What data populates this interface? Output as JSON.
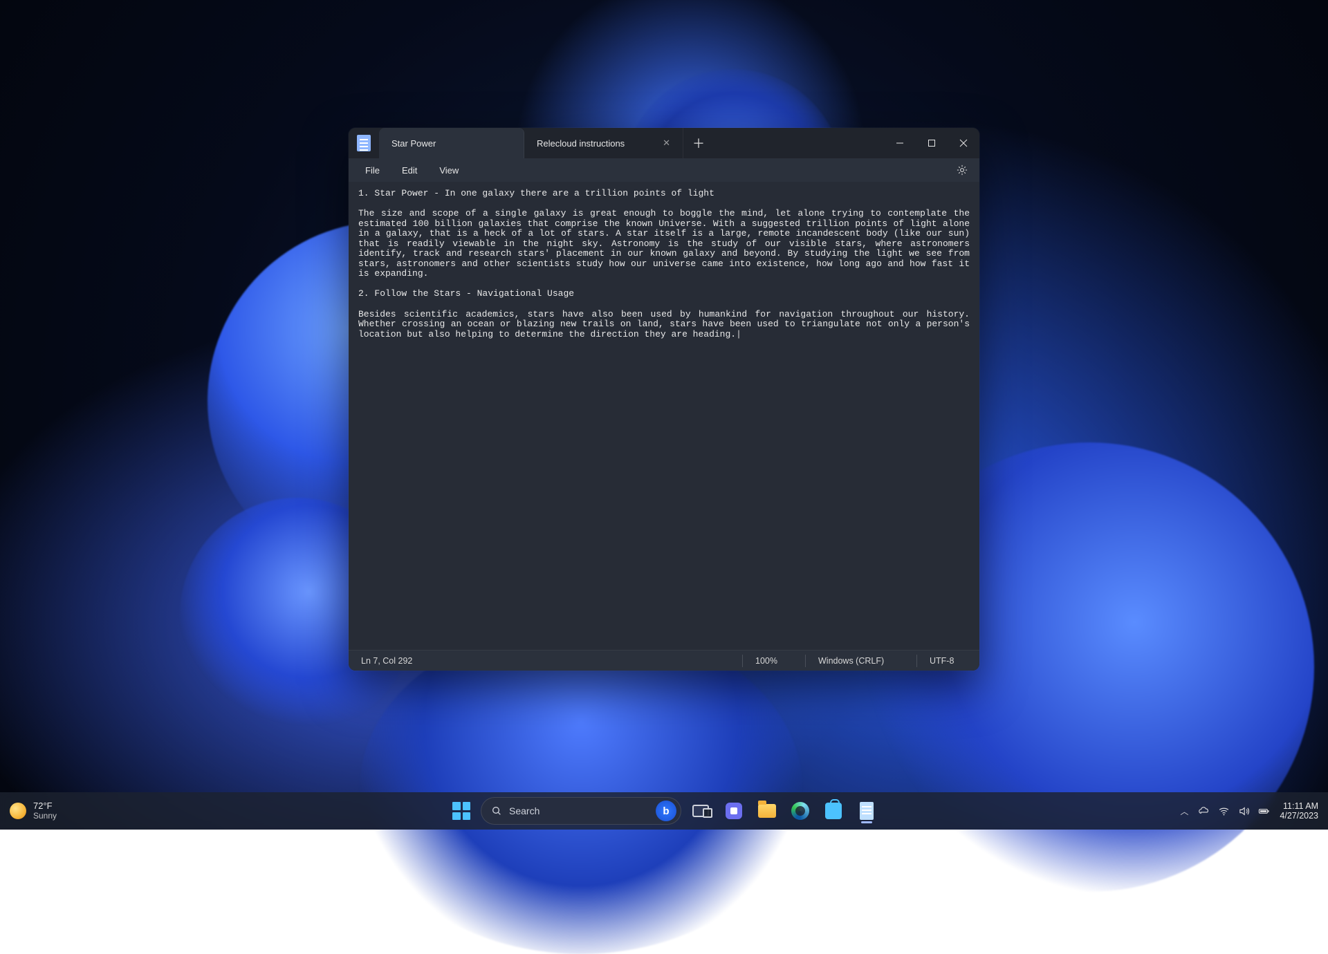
{
  "notepad": {
    "tabs": [
      {
        "title": "Star Power",
        "active": true
      },
      {
        "title": "Relecloud instructions",
        "active": false
      }
    ],
    "menu": {
      "file": "File",
      "edit": "Edit",
      "view": "View"
    },
    "content": "1. Star Power - In one galaxy there are a trillion points of light\n\nThe size and scope of a single galaxy is great enough to boggle the mind, let alone trying to contemplate the estimated 100 billion galaxies that comprise the known Universe. With a suggested trillion points of light alone in a galaxy, that is a heck of a lot of stars. A star itself is a large, remote incandescent body (like our sun) that is readily viewable in the night sky. Astronomy is the study of our visible stars, where astronomers identify, track and research stars' placement in our known galaxy and beyond. By studying the light we see from stars, astronomers and other scientists study how our universe came into existence, how long ago and how fast it is expanding.\n\n2. Follow the Stars - Navigational Usage\n\nBesides scientific academics, stars have also been used by humankind for navigation throughout our history. Whether crossing an ocean or blazing new trails on land, stars have been used to triangulate not only a person's location but also helping to determine the direction they are heading.",
    "status": {
      "position": "Ln 7, Col 292",
      "zoom": "100%",
      "line_ending": "Windows (CRLF)",
      "encoding": "UTF-8"
    }
  },
  "taskbar": {
    "weather": {
      "temp": "72°F",
      "cond": "Sunny"
    },
    "search_placeholder": "Search",
    "clock": {
      "time": "11:11 AM",
      "date": "4/27/2023"
    }
  }
}
